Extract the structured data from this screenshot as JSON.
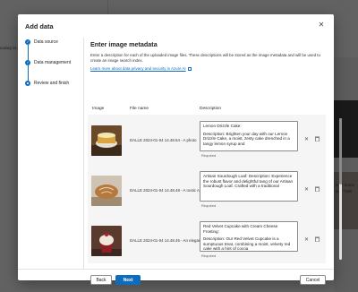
{
  "background": {
    "left_text": "curacy in yo",
    "side_texts": [
      "in of home",
      "and \"Deli"
    ]
  },
  "dialog": {
    "title": "Add data",
    "close_glyph": "✕"
  },
  "steps": [
    {
      "label": "Data source",
      "state": "completed"
    },
    {
      "label": "Data management",
      "state": "completed"
    },
    {
      "label": "Review and finish",
      "state": "current"
    }
  ],
  "content": {
    "title": "Enter image metadata",
    "description": "Enter a description for each of the uploaded image files. These descriptions will be stored as the image metadata and will be used to create an image search index.",
    "link": "Learn more about data privacy and security in Azure AI"
  },
  "table": {
    "headers": {
      "image": "Image",
      "file_name": "File name",
      "description": "Description"
    },
    "rows": [
      {
        "file_name": "DALLE 2024-01-04 14.48.54 - A photo",
        "description_lines": [
          "Lemon Drizzle Cake:",
          "Description: Brighten your day with our Lemon Drizzle Cake, a moist, zesty cake drenched in a tangy lemon syrup and"
        ],
        "required": "Required"
      },
      {
        "file_name": "DALLE 2024-01-04 14.48.48 - A rustic A",
        "description_lines": [
          "Artisan Sourdough Loaf: Description: Experience the robust flavor and delightful tang of our Artisan Sourdough Loaf. Crafted with a traditional"
        ],
        "required": "Required"
      },
      {
        "file_name": "DALLE 2024-01-04 14.48.45 - An elegan",
        "description_lines": [
          "Red Velvet Cupcake with Cream Cheese Frosting:",
          "Description: Our Red Velvet Cupcake is a sumptuous treat, combining a moist, velvety red cake with a hint of cocoa"
        ],
        "required": "Required"
      }
    ]
  },
  "footer": {
    "back": "Back",
    "next": "Next",
    "cancel": "Cancel"
  },
  "colors": {
    "accent": "#0f6cbd"
  }
}
